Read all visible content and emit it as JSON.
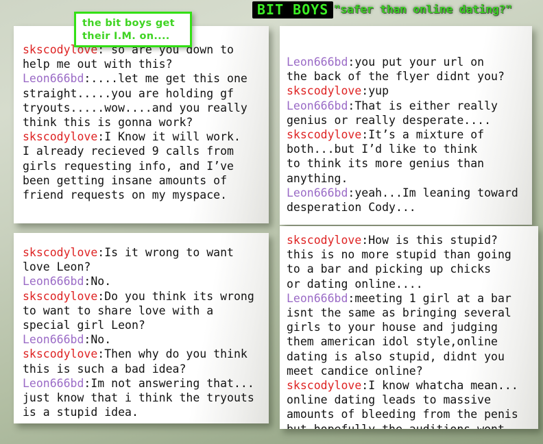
{
  "header": {
    "logo": "BIT BOYS",
    "tagline": "\"safer than online dating?\"",
    "logo_color": "#3cf024",
    "logo_bg": "#000000",
    "tagline_color": "#3ad022"
  },
  "caption": {
    "text": "the bit boys get\ntheir I.M. on....",
    "border_color": "#33e015",
    "text_color": "#3fd422"
  },
  "speakers": {
    "a": {
      "name": "skscodylove",
      "color": "#de2222"
    },
    "b": {
      "name": "Leon666bd",
      "color": "#9a6ac6"
    }
  },
  "panels": [
    {
      "id": "panel1",
      "messages": [
        {
          "speaker": "skscodylove",
          "text": ": so are you down to\nhelp me out with this?"
        },
        {
          "speaker": "Leon666bd",
          "text": ":....let me get this one\nstraight.....you are holding gf\ntryouts.....wow....and you really\nthink this is gonna work?"
        },
        {
          "speaker": "skscodylove",
          "text": ":I Know it will work.\nI already recieved 9 calls from\ngirls requesting info, and I’ve\nbeen getting insane amounts of\nfriend requests on my myspace."
        }
      ]
    },
    {
      "id": "panel2",
      "messages": [
        {
          "speaker": "Leon666bd",
          "text": ":you put your url on\nthe back of the flyer didnt you?"
        },
        {
          "speaker": "skscodylove",
          "text": ":yup"
        },
        {
          "speaker": "Leon666bd",
          "text": ":That is either really\ngenius or really desperate...."
        },
        {
          "speaker": "skscodylove",
          "text": ":It’s a mixture of\nboth...but I’d like to think\nto think its more genius than\nanything."
        },
        {
          "speaker": "Leon666bd",
          "text": ":yeah...Im leaning toward\ndesperation Cody..."
        }
      ]
    },
    {
      "id": "panel3",
      "messages": [
        {
          "speaker": "skscodylove",
          "text": ":Is it wrong to want\nlove Leon?"
        },
        {
          "speaker": "Leon666bd",
          "text": ":No."
        },
        {
          "speaker": "skscodylove",
          "text": ":Do you think its wrong\nto want to share love with a\nspecial girl Leon?"
        },
        {
          "speaker": "Leon666bd",
          "text": ":No."
        },
        {
          "speaker": "skscodylove",
          "text": ":Then why do you think\nthis is such a bad idea?"
        },
        {
          "speaker": "Leon666bd",
          "text": ":Im not answering that...\njust know that i think the tryouts\nis a stupid idea."
        }
      ]
    },
    {
      "id": "panel4",
      "messages": [
        {
          "speaker": "skscodylove",
          "text": ":How is this stupid?\nthis is no more stupid than going\nto a bar and picking up chicks\nor dating online...."
        },
        {
          "speaker": "Leon666bd",
          "text": ":meeting 1 girl at a bar\nisnt the same as bringing several\ngirls to your house and judging\nthem american idol style,online\ndating is also stupid, didnt you\nmeet candice online?"
        },
        {
          "speaker": "skscodylove",
          "text": ":I know whatcha mean...\nonline dating leads to massive\namounts of bleeding from the penis\nbut hopefully the auditions wont.."
        }
      ]
    }
  ]
}
